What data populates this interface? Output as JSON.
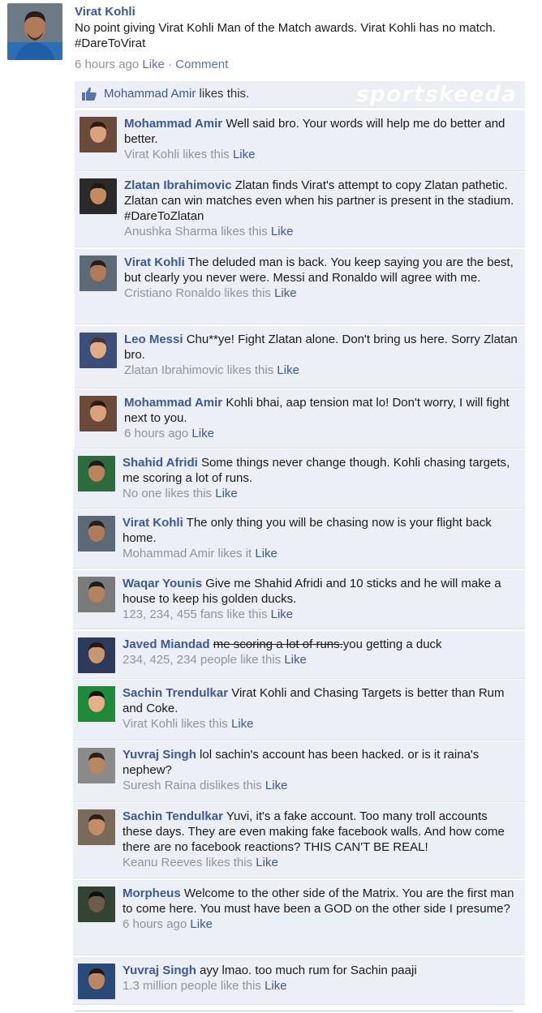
{
  "post": {
    "author": "Virat Kohli",
    "text_line1": "No point giving Virat Kohli Man of the Match awards. Virat Kohli has no match.",
    "text_line2": "#DareToVirat",
    "time": "6 hours ago",
    "like_label": "Like",
    "separator": "·",
    "comment_label": "Comment"
  },
  "likes": {
    "liker": "Mohammad Amir",
    "suffix": " likes this.",
    "watermark": "sportskeeda"
  },
  "colors": {
    "link": "#3b5998",
    "meta_gray": "#90949c",
    "comment_bg": "#eceff5"
  },
  "comments": [
    {
      "name": "Mohammad Amir",
      "text": "Well said bro. Your words will help me do better and better.",
      "meta": "Virat Kohli likes this",
      "action": "Like"
    },
    {
      "name": "Zlatan Ibrahimovic",
      "text": "Zlatan finds Virat's attempt to copy Zlatan pathetic. Zlatan can win matches even when his partner is present in the stadium. #DareToZlatan",
      "meta": "Anushka Sharma likes this",
      "action": "Like"
    },
    {
      "name": "Virat Kohli",
      "text": "The deluded man is back. You keep saying you are the best, but clearly you never were. Messi and Ronaldo will agree with me.",
      "meta": "Cristiano Ronaldo likes this",
      "action": "Like"
    },
    {
      "name": "Leo Messi",
      "text": "Chu**ye! Fight Zlatan alone. Don't bring us here. Sorry Zlatan bro.",
      "meta": "Zlatan Ibrahimovic likes this",
      "action": "Like"
    },
    {
      "name": "Mohammad Amir",
      "text": "Kohli bhai, aap tension mat lo! Don't worry, I will fight next to you.",
      "meta": "6 hours ago",
      "action": "Like"
    },
    {
      "name": "Shahid Afridi",
      "text": "Some things never change though. Kohli chasing targets, me scoring a lot of runs.",
      "meta": "No one likes this",
      "action": "Like"
    },
    {
      "name": "Virat Kohli",
      "text": "The only thing you will be chasing now is your flight back home.",
      "meta": "Mohammad Amir likes it",
      "action": "Like"
    },
    {
      "name": "Waqar Younis",
      "text": "Give me Shahid Afridi and 10 sticks and he will make a house to keep his golden ducks.",
      "meta": "123, 234, 455 fans like this",
      "action": "Like"
    },
    {
      "name": "Javed Miandad",
      "struck": "me scoring a lot of runs.",
      "text": "you getting a duck",
      "meta": "234, 425, 234 people like this",
      "action": "Like"
    },
    {
      "name": "Sachin Trendulkar",
      "text": "Virat Kohli and Chasing Targets is better than Rum and Coke.",
      "meta": "Virat Kohli likes this",
      "action": "Like"
    },
    {
      "name": "Yuvraj Singh",
      "text": "lol sachin's account has been hacked. or is it raina's nephew?",
      "meta": "Suresh Raina dislikes this",
      "action": "Like"
    },
    {
      "name": "Sachin Tendulkar",
      "text": "Yuvi, it's a fake account. Too many troll accounts these days. They are even making fake facebook walls. And how come there are no facebook reactions? THIS CAN'T BE REAL!",
      "meta": "Keanu Reeves likes this",
      "action": "Like"
    },
    {
      "name": "Morpheus",
      "text": "Welcome to the other side of the Matrix. You are the first man to come here. You must have been a GOD on the other side I presume?",
      "meta": "6 hours ago",
      "action": "Like"
    },
    {
      "name": "Yuvraj Singh",
      "text": "ayy lmao. too much rum for Sachin paaji",
      "meta": "1.3 million people like this",
      "action": "Like"
    }
  ]
}
